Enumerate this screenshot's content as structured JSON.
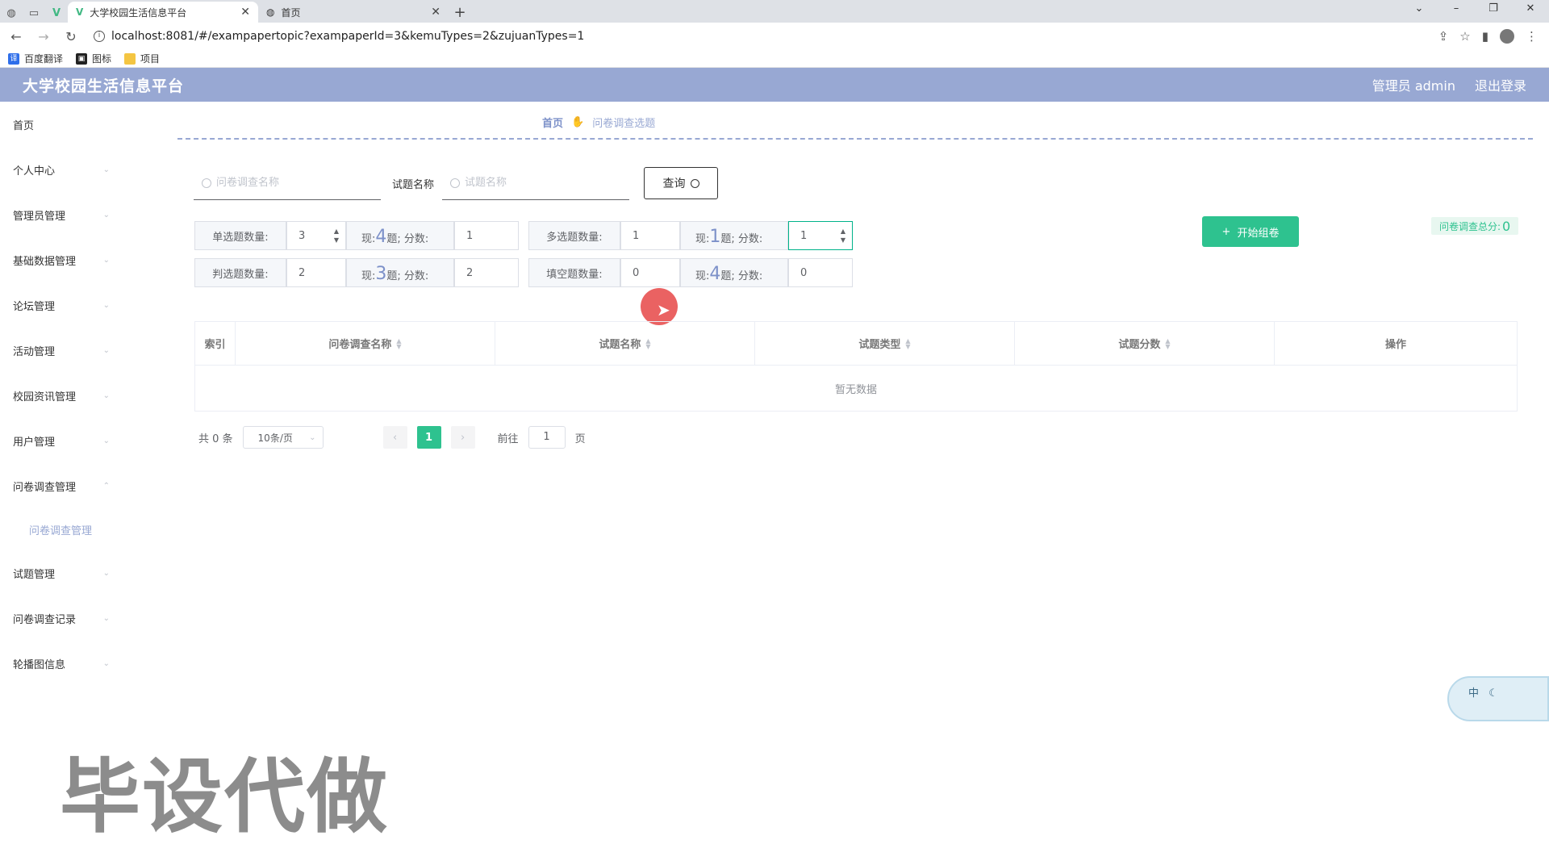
{
  "browser": {
    "tabs": [
      {
        "title": "大学校园生活信息平台",
        "active": true
      },
      {
        "title": "首页",
        "active": false
      }
    ],
    "url": "localhost:8081/#/exampapertopic?exampaperId=3&kemuTypes=2&zujuanTypes=1",
    "bookmarks": [
      {
        "label": "百度翻译",
        "icon": "translate-icon"
      },
      {
        "label": "图标",
        "icon": "image-icon"
      },
      {
        "label": "项目",
        "icon": "folder-icon"
      }
    ]
  },
  "app": {
    "title": "大学校园生活信息平台",
    "user": "管理员 admin",
    "logout": "退出登录",
    "header_color": "#98a8d3",
    "accent": "#2ec28f"
  },
  "sidebar": {
    "items": [
      {
        "label": "首页"
      },
      {
        "label": "个人中心"
      },
      {
        "label": "管理员管理"
      },
      {
        "label": "基础数据管理"
      },
      {
        "label": "论坛管理"
      },
      {
        "label": "活动管理"
      },
      {
        "label": "校园资讯管理"
      },
      {
        "label": "用户管理"
      },
      {
        "label": "问卷调查管理"
      },
      {
        "label": "问卷调查管理"
      },
      {
        "label": "试题管理"
      },
      {
        "label": "问卷调查记录"
      },
      {
        "label": "轮播图信息"
      }
    ]
  },
  "breadcrumb": {
    "home": "首页",
    "current": "问卷调查选题"
  },
  "search": {
    "survey_placeholder": "问卷调查名称",
    "question_label": "试题名称",
    "question_placeholder": "试题名称",
    "query_button": "查询"
  },
  "config": {
    "single": {
      "label": "单选题数量:",
      "count": "3",
      "now_prefix": "现:",
      "now_num": "4",
      "now_suffix": "题; 分数:",
      "score": "1"
    },
    "multi": {
      "label": "多选题数量:",
      "count": "1",
      "now_prefix": "现:",
      "now_num": "1",
      "now_suffix": "题; 分数:",
      "score": "1"
    },
    "judge": {
      "label": "判选题数量:",
      "count": "2",
      "now_prefix": "现:",
      "now_num": "3",
      "now_suffix": "题; 分数:",
      "score": "2"
    },
    "fill": {
      "label": "填空题数量:",
      "count": "0",
      "now_prefix": "现:",
      "now_num": "4",
      "now_suffix": "题; 分数:",
      "score": "0"
    }
  },
  "start_button": "开始组卷",
  "total": {
    "label": "问卷调查总分:",
    "value": "0"
  },
  "table": {
    "columns": [
      "索引",
      "问卷调查名称",
      "试题名称",
      "试题类型",
      "试题分数",
      "操作"
    ],
    "empty": "暂无数据"
  },
  "pager": {
    "total": "共 0 条",
    "page_size": "10条/页",
    "current_page": "1",
    "goto_label": "前往",
    "goto_value": "1",
    "page_suffix": "页"
  },
  "watermark": "毕设代做",
  "widget": {
    "label": "中"
  }
}
